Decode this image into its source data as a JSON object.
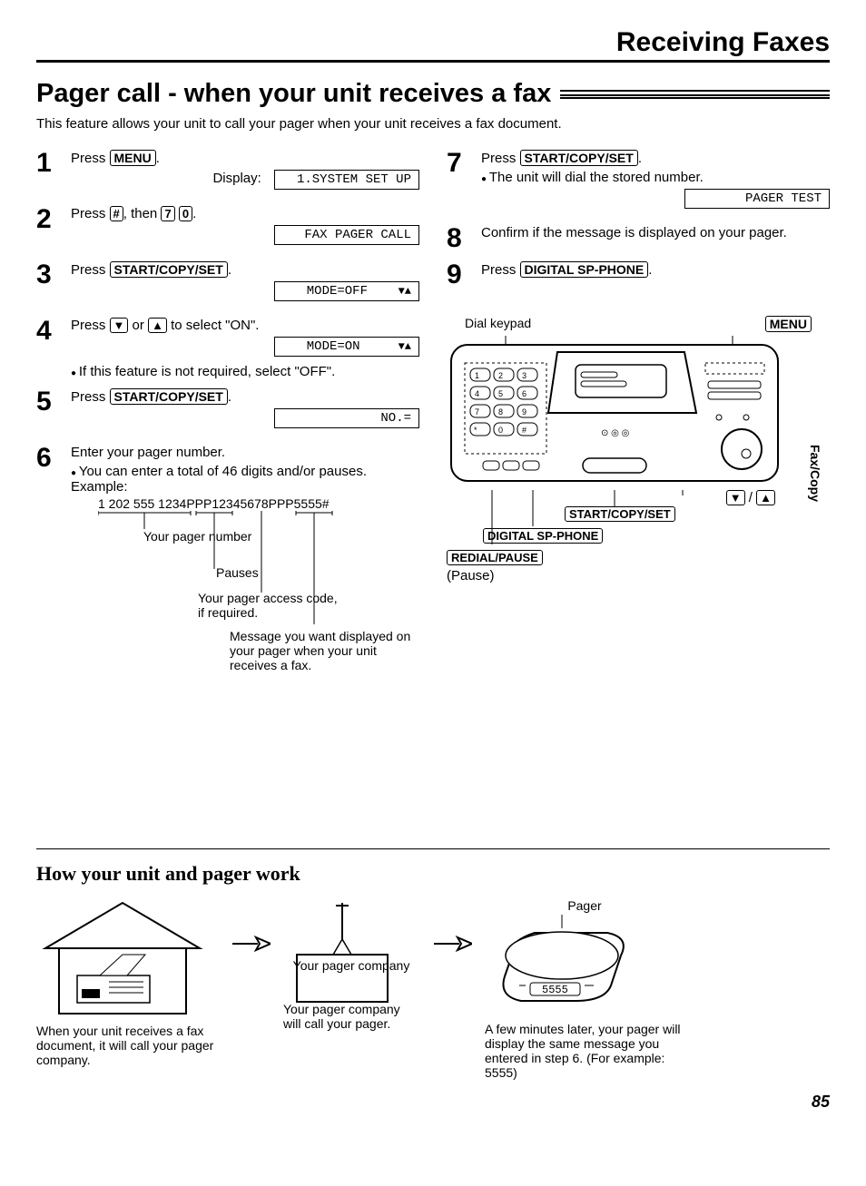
{
  "chapter_title": "Receiving Faxes",
  "page_title": "Pager call - when your unit receives a fax",
  "intro": "This feature allows your unit to call your pager when your unit receives a fax document.",
  "side_tab": "Fax/Copy",
  "page_number": "85",
  "steps": {
    "s1": {
      "num": "1",
      "text_a": "Press ",
      "key": "MENU",
      "text_b": ".",
      "display_label": "Display:",
      "display": "1.SYSTEM SET UP"
    },
    "s2": {
      "num": "2",
      "text_a": "Press ",
      "key1": "#",
      "text_b": ", then ",
      "key2": "7",
      "key3": "0",
      "text_c": ".",
      "display": "FAX PAGER CALL"
    },
    "s3": {
      "num": "3",
      "text_a": "Press ",
      "key": "START/COPY/SET",
      "text_b": ".",
      "display": "MODE=OFF",
      "arrows": "▼▲"
    },
    "s4": {
      "num": "4",
      "text_a": "Press ",
      "key1": "▼",
      "text_b": " or ",
      "key2": "▲",
      "text_c": " to select \"ON\".",
      "display": "MODE=ON",
      "arrows": "▼▲",
      "note": "If this feature is not required, select \"OFF\"."
    },
    "s5": {
      "num": "5",
      "text_a": "Press ",
      "key": "START/COPY/SET",
      "text_b": ".",
      "display": "NO.="
    },
    "s6": {
      "num": "6",
      "text": "Enter your pager number.",
      "note": "You can enter a total of 46 digits and/or pauses. Example:",
      "example": "1 202 555 1234PPP12345678PPP5555#",
      "annot1": "Your pager number",
      "annot2": "Pauses",
      "annot3": "Your pager access code, if required.",
      "annot4": "Message you want displayed on your pager when your unit receives a fax."
    },
    "s7": {
      "num": "7",
      "text_a": "Press ",
      "key": "START/COPY/SET",
      "text_b": ".",
      "note": "The unit will dial the stored number.",
      "display": "PAGER TEST"
    },
    "s8": {
      "num": "8",
      "text": "Confirm if the message is displayed on your pager."
    },
    "s9": {
      "num": "9",
      "text_a": "Press ",
      "key": "DIGITAL SP-PHONE",
      "text_b": "."
    }
  },
  "diagram": {
    "dial_keypad": "Dial keypad",
    "menu": "MENU",
    "arrows": "▼ / ▲",
    "start": "START/COPY/SET",
    "digital": "DIGITAL SP-PHONE",
    "redial": "REDIAL/PAUSE",
    "pause": "(Pause)"
  },
  "how": {
    "title": "How your unit and pager work",
    "c1_label": "",
    "c1_caption": "When your unit receives a fax document, it will call your pager company.",
    "c2_label": "Your pager company",
    "c2_caption": "Your pager company will call your pager.",
    "c3_label": "Pager",
    "c3_caption": "A few minutes later, your pager will display the same message you entered in step 6. (For example: 5555)",
    "pager_display": "5555"
  }
}
